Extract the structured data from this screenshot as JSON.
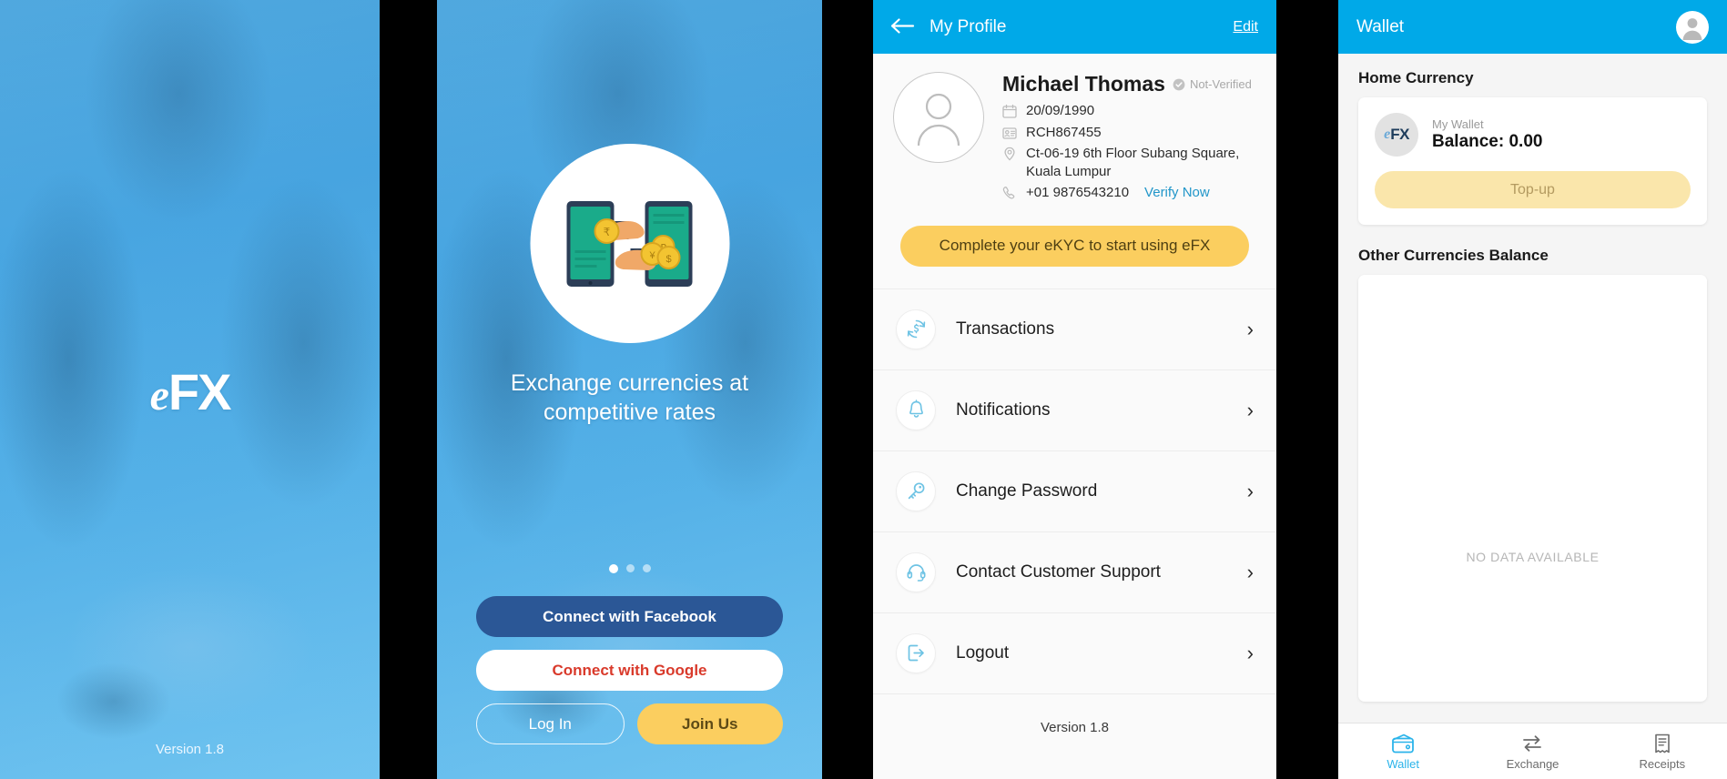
{
  "splash": {
    "logo_e": "e",
    "logo_fx": "FX",
    "version": "Version 1.8"
  },
  "onboarding": {
    "illustration": "money-exchange-phones-illustration",
    "tagline": "Exchange currencies at competitive rates",
    "dots": [
      {
        "active": true
      },
      {
        "active": false
      },
      {
        "active": false
      }
    ],
    "buttons": {
      "facebook": "Connect with Facebook",
      "google": "Connect with Google",
      "login": "Log In",
      "join": "Join Us"
    }
  },
  "profile": {
    "appbar": {
      "back_icon": "arrow-left-icon",
      "title": "My Profile",
      "edit": "Edit"
    },
    "avatar_icon": "user-avatar-icon",
    "name": "Michael Thomas",
    "verification_badge": "Not-Verified",
    "dob": "20/09/1990",
    "id_number": "RCH867455",
    "address": "Ct-06-19 6th Floor Subang Square, Kuala Lumpur",
    "phone": "+01 9876543210",
    "verify_link": "Verify Now",
    "kyc_cta": "Complete your eKYC to start using eFX",
    "menu": [
      {
        "label": "Transactions",
        "icon": "currency-refresh-icon"
      },
      {
        "label": "Notifications",
        "icon": "bell-icon"
      },
      {
        "label": "Change Password",
        "icon": "key-icon"
      },
      {
        "label": "Contact Customer Support",
        "icon": "headset-icon"
      },
      {
        "label": "Logout",
        "icon": "logout-icon"
      }
    ],
    "version": "Version 1.8"
  },
  "wallet": {
    "appbar": {
      "title": "Wallet",
      "avatar_icon": "user-avatar-icon"
    },
    "home_currency_title": "Home Currency",
    "wallet_card": {
      "badge_e": "e",
      "badge_fx": "FX",
      "subtitle": "My Wallet",
      "balance": "Balance: 0.00",
      "topup_label": "Top-up"
    },
    "other_currencies_title": "Other Currencies Balance",
    "empty_state": "NO DATA AVAILABLE",
    "tabs": [
      {
        "label": "Wallet",
        "icon": "wallet-icon",
        "active": true
      },
      {
        "label": "Exchange",
        "icon": "exchange-arrows-icon",
        "active": false
      },
      {
        "label": "Receipts",
        "icon": "receipt-icon",
        "active": false
      }
    ]
  },
  "colors": {
    "brand_cyan": "#00a9e8",
    "splash_blue": "#4aa8e0",
    "accent_yellow": "#fbce5f",
    "facebook_blue": "#2b5796",
    "google_red": "#d93a2b",
    "link_blue": "#2196c9",
    "tab_active": "#2bb4ea"
  }
}
